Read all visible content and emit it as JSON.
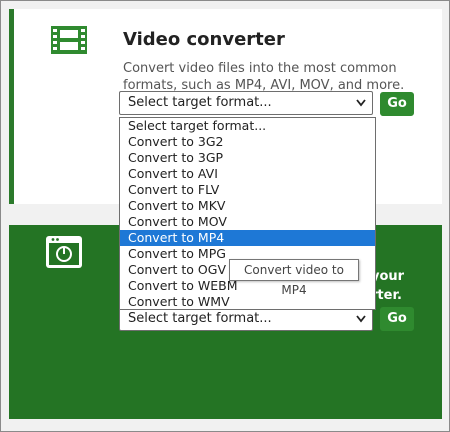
{
  "video_card": {
    "icon": "film-icon",
    "title": "Video converter",
    "description": "Convert video files into the most common formats, such as MP4, AVI, MOV, and more.",
    "select_value": "Select target format...",
    "go_label": "Go"
  },
  "dropdown": {
    "options": [
      "Select target format...",
      "Convert to 3G2",
      "Convert to 3GP",
      "Convert to AVI",
      "Convert to FLV",
      "Convert to MKV",
      "Convert to MOV",
      "Convert to MP4",
      "Convert to MPG",
      "Convert to OGV",
      "Convert to WEBM",
      "Convert to WMV"
    ],
    "highlighted": "Convert to MP4"
  },
  "tooltip": "Convert video to MP4",
  "second_card": {
    "icon": "browser-icon",
    "desc_line1": "your",
    "desc_line2": "rter.",
    "select_value": "Select target format...",
    "go_label": "Go"
  },
  "colors": {
    "accent_green": "#2f8a2f",
    "dark_green": "#247424",
    "highlight_blue": "#1e78d6"
  }
}
